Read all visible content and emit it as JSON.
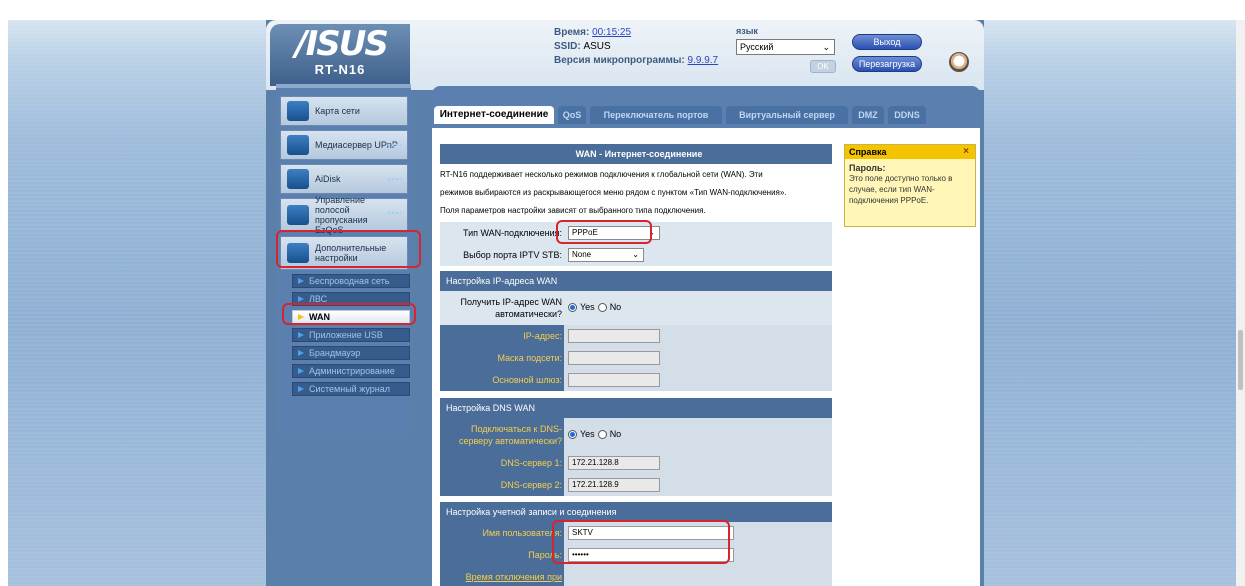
{
  "header": {
    "logo": "/ISUS",
    "model": "RT-N16",
    "time_label": "Время:",
    "time_value": "00:15:25",
    "ssid_label": "SSID:",
    "ssid_value": "ASUS",
    "firmware_label": "Версия микропрограммы:",
    "firmware_value": "9.9.9.7",
    "lang_label": "язык",
    "lang_value": "Русский",
    "ok_label": "OK",
    "logout_label": "Выход",
    "reboot_label": "Перезагрузка"
  },
  "sidebar": {
    "items": [
      {
        "label": "Карта сети",
        "icon": "network-map-icon"
      },
      {
        "label": "Медиасервер UPnP",
        "icon": "media-server-icon"
      },
      {
        "label": "AiDisk",
        "icon": "aidisk-icon"
      },
      {
        "label": "Управление полосой пропускания EzQoS",
        "icon": "qos-icon"
      },
      {
        "label": "Дополнительные настройки",
        "icon": "advanced-settings-icon"
      }
    ],
    "sub_items": [
      {
        "label": "Беспроводная сеть"
      },
      {
        "label": "ЛВС"
      },
      {
        "label": "WAN"
      },
      {
        "label": "Приложение USB"
      },
      {
        "label": "Брандмауэр"
      },
      {
        "label": "Администрирование"
      },
      {
        "label": "Системный журнал"
      }
    ]
  },
  "tabs": [
    {
      "label": "Интернет-соединение"
    },
    {
      "label": "QoS"
    },
    {
      "label": "Переключатель портов"
    },
    {
      "label": "Виртуальный сервер"
    },
    {
      "label": "DMZ"
    },
    {
      "label": "DDNS"
    }
  ],
  "main": {
    "title": "WAN - Интернет-соединение",
    "desc_line1": "RT-N16 поддерживает несколько режимов подключения к глобальной сети (WAN). Эти",
    "desc_line2": "режимов выбираются из раскрывающегося меню рядом с пунктом «Тип WAN-подключения».",
    "desc_line3": "Поля параметров настройки зависят от выбранного типа подключения.",
    "wan_type_label": "Тип WAN-подключения:",
    "wan_type_value": "PPPoE",
    "iptv_label": "Выбор порта IPTV STB:",
    "iptv_value": "None",
    "ip_section_title": "Настройка IP-адреса WAN",
    "auto_ip_label_1": "Получить IP-адрес WAN",
    "auto_ip_label_2": "автоматически?",
    "yes": "Yes",
    "no": "No",
    "ip_label": "IP-адрес:",
    "mask_label": "Маска подсети:",
    "gw_label": "Основной шлюз:",
    "dns_section_title": "Настройка DNS WAN",
    "auto_dns_label_1": "Подключаться к DNS-",
    "auto_dns_label_2": "серверу автоматически?",
    "dns1_label": "DNS-сервер 1:",
    "dns1_value": "172.21.128.8",
    "dns2_label": "DNS-сервер 2:",
    "dns2_value": "172.21.128.9",
    "account_section_title": "Настройка учетной записи и соединения",
    "user_label": "Имя пользователя:",
    "user_value": "SKTV",
    "pass_label": "Пароль:",
    "pass_value": "••••••",
    "idle_label": "Время отключения при"
  },
  "help": {
    "title": "Справка",
    "close": "×",
    "heading": "Пароль:",
    "body": "Это поле доступно только в случае, если тип WAN-подключения PPPoE."
  }
}
